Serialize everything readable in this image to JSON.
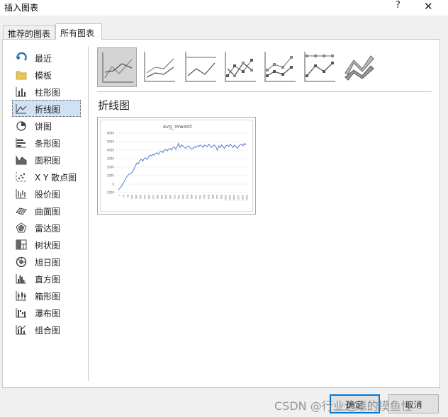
{
  "window": {
    "title": "插入图表",
    "help": "?",
    "close": "✕"
  },
  "tabs": [
    {
      "label": "推荐的图表",
      "active": false
    },
    {
      "label": "所有图表",
      "active": true
    }
  ],
  "sidebar": {
    "items": [
      {
        "label": "最近",
        "icon": "recent-icon"
      },
      {
        "label": "模板",
        "icon": "folder-icon"
      },
      {
        "label": "柱形图",
        "icon": "column-chart-icon"
      },
      {
        "label": "折线图",
        "icon": "line-chart-icon",
        "selected": true
      },
      {
        "label": "饼图",
        "icon": "pie-chart-icon"
      },
      {
        "label": "条形图",
        "icon": "bar-chart-icon"
      },
      {
        "label": "面积图",
        "icon": "area-chart-icon"
      },
      {
        "label": "X Y 散点图",
        "icon": "scatter-chart-icon"
      },
      {
        "label": "股价图",
        "icon": "stock-chart-icon"
      },
      {
        "label": "曲面图",
        "icon": "surface-chart-icon"
      },
      {
        "label": "雷达图",
        "icon": "radar-chart-icon"
      },
      {
        "label": "树状图",
        "icon": "treemap-chart-icon"
      },
      {
        "label": "旭日图",
        "icon": "sunburst-chart-icon"
      },
      {
        "label": "直方图",
        "icon": "histogram-chart-icon"
      },
      {
        "label": "箱形图",
        "icon": "box-whisker-chart-icon"
      },
      {
        "label": "瀑布图",
        "icon": "waterfall-chart-icon"
      },
      {
        "label": "组合图",
        "icon": "combo-chart-icon"
      }
    ]
  },
  "subtypes": [
    {
      "icon": "line-subtype-icon",
      "selected": true
    },
    {
      "icon": "stacked-line-subtype-icon"
    },
    {
      "icon": "percent-stacked-line-subtype-icon"
    },
    {
      "icon": "line-with-markers-subtype-icon"
    },
    {
      "icon": "stacked-line-markers-subtype-icon"
    },
    {
      "icon": "percent-stacked-line-markers-subtype-icon"
    },
    {
      "icon": "3d-line-subtype-icon"
    }
  ],
  "section_title": "折线图",
  "preview": {
    "chart_data": {
      "type": "line",
      "title": "avg_reward",
      "ylim": [
        -1000,
        6000
      ],
      "yticks": [
        "6000",
        "5000",
        "4000",
        "3000",
        "2000",
        "1000",
        "0",
        "-1000"
      ],
      "xticks": [
        "1",
        "41",
        "81",
        "121",
        "161",
        "201",
        "241",
        "281",
        "321",
        "361",
        "401",
        "441",
        "481",
        "521",
        "561",
        "601",
        "641",
        "681",
        "721",
        "761",
        "801",
        "841",
        "881",
        "921",
        "961",
        "1001",
        "1041",
        "1081",
        "1121",
        "1161",
        "1201"
      ],
      "series": [
        {
          "color": "#4472c4",
          "values": [
            -700,
            -500,
            -300,
            0,
            300,
            600,
            900,
            1100,
            1200,
            1300,
            1500,
            1800,
            2200,
            2500,
            2400,
            2800,
            2900,
            2700,
            3000,
            3100,
            2900,
            3200,
            3400,
            3300,
            3500,
            3400,
            3600,
            3700,
            3500,
            3800,
            3900,
            3700,
            4000,
            4100,
            3900,
            4100,
            4200,
            4000,
            4300,
            4400,
            4100,
            4400,
            4800,
            4300,
            4600,
            4500,
            4300,
            4200,
            4400,
            4500,
            4300,
            4100,
            4200,
            4400,
            4300,
            4500,
            4400,
            4600,
            4500,
            4300,
            4600,
            4500,
            4400,
            4700,
            4500,
            4300,
            4500,
            4600,
            4400,
            4000,
            4500,
            4300,
            4600,
            4400,
            4200,
            4500,
            4600,
            4400,
            4700,
            4500,
            4300,
            4600,
            4400,
            4200,
            4500,
            4600,
            4700,
            4500,
            4800,
            4600
          ]
        }
      ]
    }
  },
  "buttons": {
    "ok": "确定",
    "cancel": "取消"
  },
  "watermark": "CSDN @行业边缘的摸鱼怪"
}
